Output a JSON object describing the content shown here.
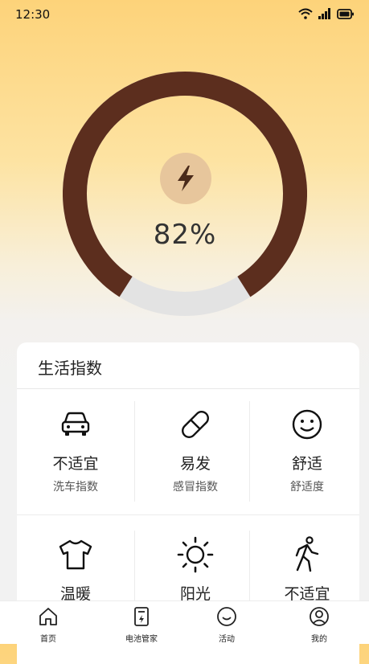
{
  "status": {
    "time": "12:30"
  },
  "battery": {
    "percent_text": "82%",
    "level": 0.82,
    "ring_color": "#5c2e1e",
    "track_color": "#e3e3e3"
  },
  "life_index": {
    "title": "生活指数",
    "items": [
      {
        "icon": "car-icon",
        "value": "不适宜",
        "label": "洗车指数"
      },
      {
        "icon": "pill-icon",
        "value": "易发",
        "label": "感冒指数"
      },
      {
        "icon": "smile-icon",
        "value": "舒适",
        "label": "舒适度"
      },
      {
        "icon": "tshirt-icon",
        "value": "温暖",
        "label": ""
      },
      {
        "icon": "sun-icon",
        "value": "阳光",
        "label": ""
      },
      {
        "icon": "walking-icon",
        "value": "不适宜",
        "label": ""
      }
    ]
  },
  "tabs": [
    {
      "icon": "home-icon",
      "label": "首页"
    },
    {
      "icon": "battery-manager-icon",
      "label": "电池管家"
    },
    {
      "icon": "activity-icon",
      "label": "活动"
    },
    {
      "icon": "profile-icon",
      "label": "我的"
    }
  ]
}
